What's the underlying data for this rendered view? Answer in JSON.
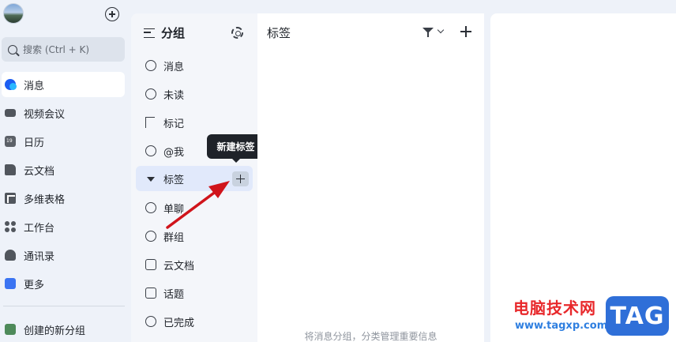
{
  "nav": {
    "search_placeholder": "搜索 (Ctrl + K)",
    "items": [
      {
        "label": "消息"
      },
      {
        "label": "视频会议"
      },
      {
        "label": "日历"
      },
      {
        "label": "云文档"
      },
      {
        "label": "多维表格"
      },
      {
        "label": "工作台"
      },
      {
        "label": "通讯录"
      },
      {
        "label": "更多"
      }
    ],
    "custom_group": "创建的新分组"
  },
  "groups": {
    "title": "分组",
    "items": [
      {
        "label": "消息"
      },
      {
        "label": "未读"
      },
      {
        "label": "标记"
      },
      {
        "label": "@我"
      },
      {
        "label": "标签"
      },
      {
        "label": "单聊"
      },
      {
        "label": "群组"
      },
      {
        "label": "云文档"
      },
      {
        "label": "话题"
      },
      {
        "label": "已完成"
      }
    ],
    "tooltip": "新建标签"
  },
  "panel": {
    "title": "标签",
    "hint": "将消息分组，分类管理重要信息"
  },
  "watermark": {
    "title": "电脑技术网",
    "url": "www.tagxp.com",
    "logo": "TAG"
  },
  "colors": {
    "accent": "#1d5ef2",
    "selected_bg": "#e1e9fb",
    "arrow": "#d0141b"
  }
}
